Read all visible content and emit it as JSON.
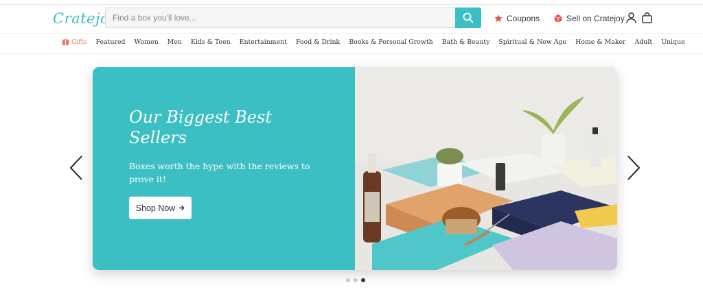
{
  "brand": {
    "logo_text": "Cratejoy",
    "accent": "#3cbfc2"
  },
  "search": {
    "placeholder": "Find a box you'll love..."
  },
  "header": {
    "coupons_label": "Coupons",
    "sell_label": "Sell on Cratejoy",
    "icons": [
      "search-icon",
      "star-icon",
      "box-icon",
      "user-icon",
      "bag-icon"
    ]
  },
  "nav": {
    "items": [
      "Gifts",
      "Featured",
      "Women",
      "Men",
      "Kids & Teen",
      "Entertainment",
      "Food & Drink",
      "Books & Personal Growth",
      "Bath & Beauty",
      "Spiritual & New Age",
      "Home & Maker",
      "Adult",
      "Unique"
    ]
  },
  "hero": {
    "title": "Our Biggest Best Sellers",
    "subtitle": "Boxes worth the hype with the reviews to prove it!",
    "cta_label": "Shop Now"
  },
  "carousel": {
    "slide_count": 3,
    "active_slide": 3
  }
}
